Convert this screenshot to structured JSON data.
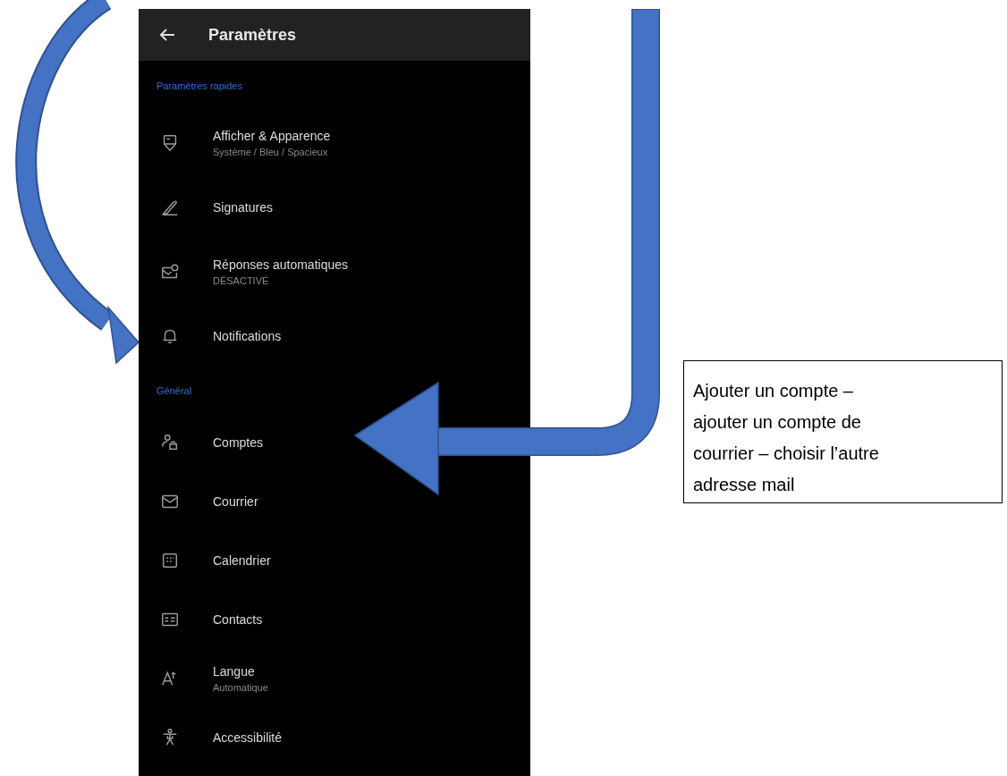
{
  "screen": {
    "header": {
      "title": "Paramètres"
    },
    "sections": [
      {
        "title": "Paramètres rapides",
        "items": [
          {
            "kind": "display",
            "label": "Afficher & Apparence",
            "subtitle": "Système / Bleu / Spacieux"
          },
          {
            "kind": "signature",
            "label": "Signatures"
          },
          {
            "kind": "autoreply",
            "label": "Réponses automatiques",
            "subtitle": "DÉSACTIVÉ"
          },
          {
            "kind": "bell",
            "label": "Notifications"
          }
        ]
      },
      {
        "title": "Général",
        "items": [
          {
            "kind": "accounts",
            "label": "Comptes"
          },
          {
            "kind": "mail",
            "label": "Courrier"
          },
          {
            "kind": "calendar",
            "label": "Calendrier"
          },
          {
            "kind": "contacts",
            "label": "Contacts"
          },
          {
            "kind": "language",
            "label": "Langue",
            "subtitle": "Automatique"
          },
          {
            "kind": "accessibility",
            "label": "Accessibilité"
          }
        ]
      }
    ]
  },
  "callout": {
    "text": "Ajouter un compte – ajouter un compte de courrier – choisir l’autre adresse mail"
  }
}
